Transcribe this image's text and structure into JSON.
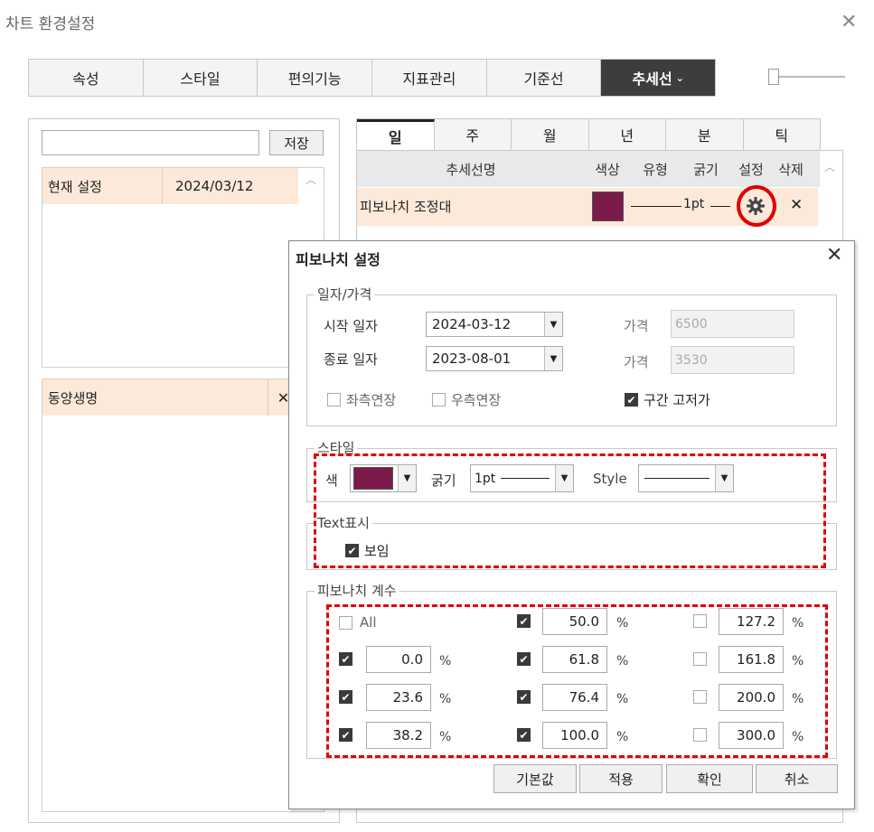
{
  "window": {
    "title": "차트 환경설정",
    "close_icon": "✕"
  },
  "main_tabs": [
    {
      "label": "속성",
      "active": false
    },
    {
      "label": "스타일",
      "active": false
    },
    {
      "label": "편의기능",
      "active": false
    },
    {
      "label": "지표관리",
      "active": false
    },
    {
      "label": "기준선",
      "active": false
    },
    {
      "label": "추세선",
      "active": true,
      "chevron": "⌄"
    }
  ],
  "left": {
    "save_input_value": "",
    "save_button": "저장",
    "settings_list": [
      {
        "name": "현재 설정",
        "date": "2024/03/12"
      }
    ],
    "stock_list": [
      {
        "name": "동양생명",
        "remove": "✕"
      }
    ]
  },
  "period_tabs": [
    {
      "label": "일",
      "active": true
    },
    {
      "label": "주",
      "active": false
    },
    {
      "label": "월",
      "active": false
    },
    {
      "label": "년",
      "active": false
    },
    {
      "label": "분",
      "active": false
    },
    {
      "label": "틱",
      "active": false
    }
  ],
  "trend_table": {
    "headers": {
      "name": "추세선명",
      "color": "색상",
      "type": "유형",
      "width": "굵기",
      "settings": "설정",
      "delete": "삭제"
    },
    "rows": [
      {
        "name": "피보나치 조정대",
        "color": "#7b1a4b",
        "width": "1pt",
        "delete": "✕"
      }
    ]
  },
  "fib_dialog": {
    "title": "피보나치 설정",
    "close": "✕",
    "date_price": {
      "legend": "일자/가격",
      "start_label": "시작 일자",
      "start_value": "2024-03-12",
      "end_label": "종료 일자",
      "end_value": "2023-08-01",
      "price_label_1": "가격",
      "price_value_1": "6500",
      "price_label_2": "가격",
      "price_value_2": "3530",
      "left_extend": "좌측연장",
      "right_extend": "우측연장",
      "fixed_interval": "구간 고저가"
    },
    "style": {
      "legend": "스타일",
      "color_label": "색",
      "color": "#7b1a4b",
      "width_label": "굵기",
      "width_value": "1pt",
      "style_label": "Style"
    },
    "text_display": {
      "legend": "Text표시",
      "show_label": "보임"
    },
    "coefficients": {
      "legend": "피보나치 계수",
      "all_label": "All",
      "percent": "%",
      "col1": [
        {
          "value": "0.0",
          "checked": true
        },
        {
          "value": "23.6",
          "checked": true
        },
        {
          "value": "38.2",
          "checked": true
        }
      ],
      "col2": [
        {
          "value": "50.0",
          "checked": true
        },
        {
          "value": "61.8",
          "checked": true
        },
        {
          "value": "76.4",
          "checked": true
        },
        {
          "value": "100.0",
          "checked": true
        }
      ],
      "col3": [
        {
          "value": "127.2",
          "checked": false
        },
        {
          "value": "161.8",
          "checked": false
        },
        {
          "value": "200.0",
          "checked": false
        },
        {
          "value": "300.0",
          "checked": false
        }
      ]
    },
    "buttons": {
      "default": "기본값",
      "apply": "적용",
      "ok": "확인",
      "cancel": "취소"
    }
  }
}
